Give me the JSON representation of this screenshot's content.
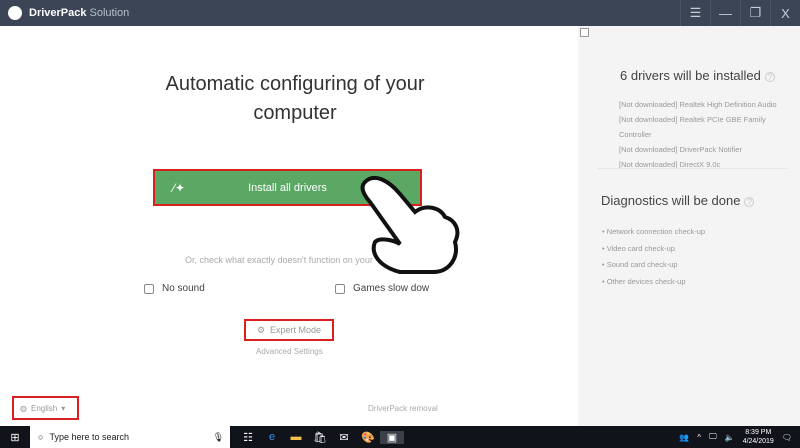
{
  "titlebar": {
    "app_name": "DriverPack",
    "app_suffix": "Solution",
    "menu": "☰",
    "minimize": "—",
    "restore": "❐",
    "close": "X"
  },
  "main": {
    "headline": "Automatic configuring of your computer",
    "install_button": "Install all drivers",
    "hint": "Or, check what exactly doesn't function on your",
    "options": [
      "No sound",
      "Games slow dow"
    ],
    "expert_mode": "Expert Mode",
    "advanced_settings": "Advanced Settings",
    "language": "English",
    "removal": "DriverPack removal"
  },
  "sidebar": {
    "drivers_title": "6 drivers will be installed",
    "drivers": [
      "[Not downloaded] Realtek High Definition Audio",
      "[Not downloaded] Realtek PCIe GBE Family Controller",
      "[Not downloaded] DriverPack Notifier",
      "[Not downloaded] DirectX 9.0c"
    ],
    "diagnostics_title": "Diagnostics will be done",
    "diagnostics": [
      "• Network connection check-up",
      "• Video card check-up",
      "• Sound card check-up",
      "• Other devices check-up"
    ]
  },
  "taskbar": {
    "search_placeholder": "Type here to search",
    "time": "8:39 PM",
    "date": "4/24/2019"
  },
  "colors": {
    "accent": "#5aa864",
    "titlebar": "#3b4556",
    "highlight": "#d9201f"
  }
}
